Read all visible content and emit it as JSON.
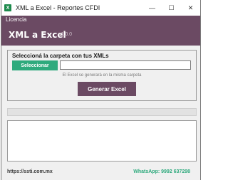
{
  "window": {
    "title": "XML a Excel - Reportes CFDI",
    "icon": "excel-icon",
    "controls": {
      "minimize": "—",
      "maximize": "☐",
      "close": "✕"
    }
  },
  "menu": {
    "items": [
      "Licencia"
    ]
  },
  "header": {
    "title": "XML a Excel",
    "version": "v1.0.0"
  },
  "folder_panel": {
    "label": "Seleccioná la carpeta con tus XMLs",
    "select_button": "Seleccionar",
    "path_value": "",
    "note": "El Excel se generará en la misma carpeta",
    "generate_button": "Generar Excel"
  },
  "progress": {
    "value": 0
  },
  "log": {
    "text": ""
  },
  "footer": {
    "link": "https://ssti.com.mx",
    "whatsapp": "WhatsApp: 9992 637298"
  },
  "colors": {
    "brand": "#6b4a63",
    "accent": "#2eaa7d"
  }
}
